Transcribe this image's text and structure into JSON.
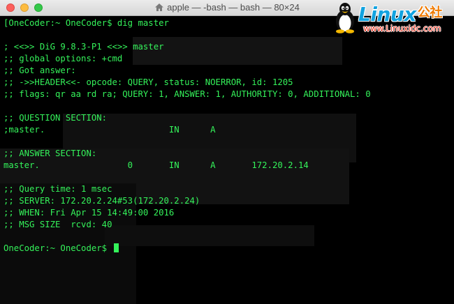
{
  "window": {
    "title": "apple — -bash — bash — 80×24"
  },
  "logo": {
    "brand": "Linux",
    "brand_cn": "公社",
    "url": "www.Linuxidc.com"
  },
  "terminal": {
    "text_color": "#34f25a",
    "lines": [
      "[OneCoder:~ OneCoder$ dig master",
      "",
      "; <<>> DiG 9.8.3-P1 <<>> master",
      ";; global options: +cmd",
      ";; Got answer:",
      ";; ->>HEADER<<- opcode: QUERY, status: NOERROR, id: 1205",
      ";; flags: qr aa rd ra; QUERY: 1, ANSWER: 1, AUTHORITY: 0, ADDITIONAL: 0",
      "",
      ";; QUESTION SECTION:",
      ";master.                        IN      A",
      "",
      ";; ANSWER SECTION:",
      "master.                 0       IN      A       172.20.2.14",
      "",
      ";; Query time: 1 msec",
      ";; SERVER: 172.20.2.24#53(172.20.2.24)",
      ";; WHEN: Fri Apr 15 14:49:00 2016",
      ";; MSG SIZE  rcvd: 40",
      "",
      "OneCoder:~ OneCoder$ "
    ]
  }
}
